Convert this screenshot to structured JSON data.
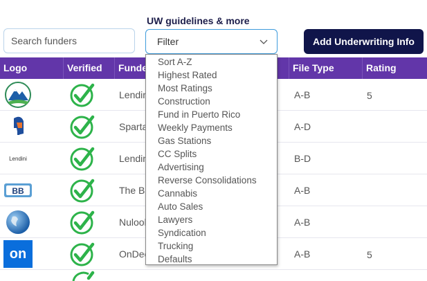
{
  "search": {
    "placeholder": "Search funders"
  },
  "filter": {
    "label": "UW guidelines & more",
    "selected": "Filter",
    "options": [
      "Sort A-Z",
      "Highest Rated",
      "Most Ratings",
      "Construction",
      "Fund in Puerto Rico",
      "Weekly Payments",
      "Gas Stations",
      "CC Splits",
      "Advertising",
      "Reverse Consolidations",
      "Cannabis",
      "Auto Sales",
      "Lawyers",
      "Syndication",
      "Trucking",
      "Defaults"
    ]
  },
  "actions": {
    "add_label": "Add Underwriting Info"
  },
  "table": {
    "headers": {
      "logo": "Logo",
      "verified": "Verified",
      "funder": "Funder",
      "filetype": "File Type",
      "rating": "Rating"
    },
    "rows": [
      {
        "logo": "mountain-logo",
        "funder": "Lendini",
        "filetype": "A-B",
        "rating": "5"
      },
      {
        "logo": "spartan-logo",
        "funder": "Spartan",
        "filetype": "A-D",
        "rating": ""
      },
      {
        "logo": "lendini-text-logo",
        "logo_text": "Lendini",
        "funder": "Lendini",
        "filetype": "B-D",
        "rating": ""
      },
      {
        "logo": "bb-logo",
        "funder": "The BB",
        "filetype": "A-B",
        "rating": ""
      },
      {
        "logo": "globe-logo",
        "funder": "Nulook",
        "filetype": "A-B",
        "rating": ""
      },
      {
        "logo": "on-logo",
        "logo_text": "on",
        "funder": "OnDeck",
        "filetype": "A-B",
        "rating": "5"
      }
    ]
  },
  "colors": {
    "header_bg": "#6236a9",
    "button_bg": "#10154a",
    "check": "#2db34a",
    "focus_border": "#3d9bdc"
  }
}
